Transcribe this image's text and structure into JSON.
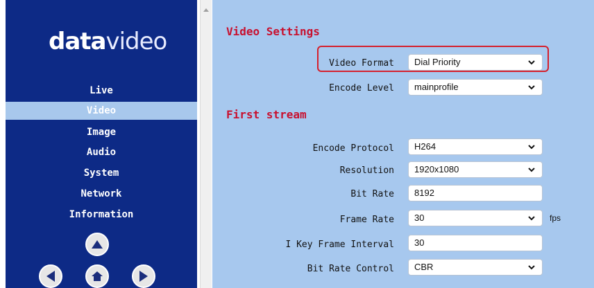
{
  "sidebar": {
    "logo_bold": "data",
    "logo_light": "video",
    "items": [
      {
        "label": "Live"
      },
      {
        "label": "Video"
      },
      {
        "label": "Image"
      },
      {
        "label": "Audio"
      },
      {
        "label": "System"
      },
      {
        "label": "Network"
      },
      {
        "label": "Information"
      }
    ],
    "active_item": "Video"
  },
  "main": {
    "video_settings": {
      "title": "Video Settings",
      "video_format_label": "Video Format",
      "video_format_value": "Dial Priority",
      "encode_level_label": "Encode Level",
      "encode_level_value": "mainprofile"
    },
    "first_stream": {
      "title": "First stream",
      "encode_protocol_label": "Encode Protocol",
      "encode_protocol_value": "H264",
      "resolution_label": "Resolution",
      "resolution_value": "1920x1080",
      "bit_rate_label": "Bit Rate",
      "bit_rate_value": "8192",
      "frame_rate_label": "Frame Rate",
      "frame_rate_value": "30",
      "frame_rate_unit": "fps",
      "key_frame_label": "I Key Frame Interval",
      "key_frame_value": "30",
      "bit_rate_control_label": "Bit Rate Control",
      "bit_rate_control_value": "CBR"
    }
  },
  "colors": {
    "sidebar_bg": "#0d2a86",
    "active_item_bg": "#a8c8ec",
    "main_bg": "#a7c8ee",
    "section_title": "#c8102e",
    "highlight_border": "#d61f2b"
  },
  "icons": {
    "ptz_up": "up-arrow-icon",
    "ptz_left": "left-arrow-icon",
    "ptz_home": "home-icon",
    "ptz_right": "right-arrow-icon",
    "select_chevron": "chevron-down-icon"
  }
}
